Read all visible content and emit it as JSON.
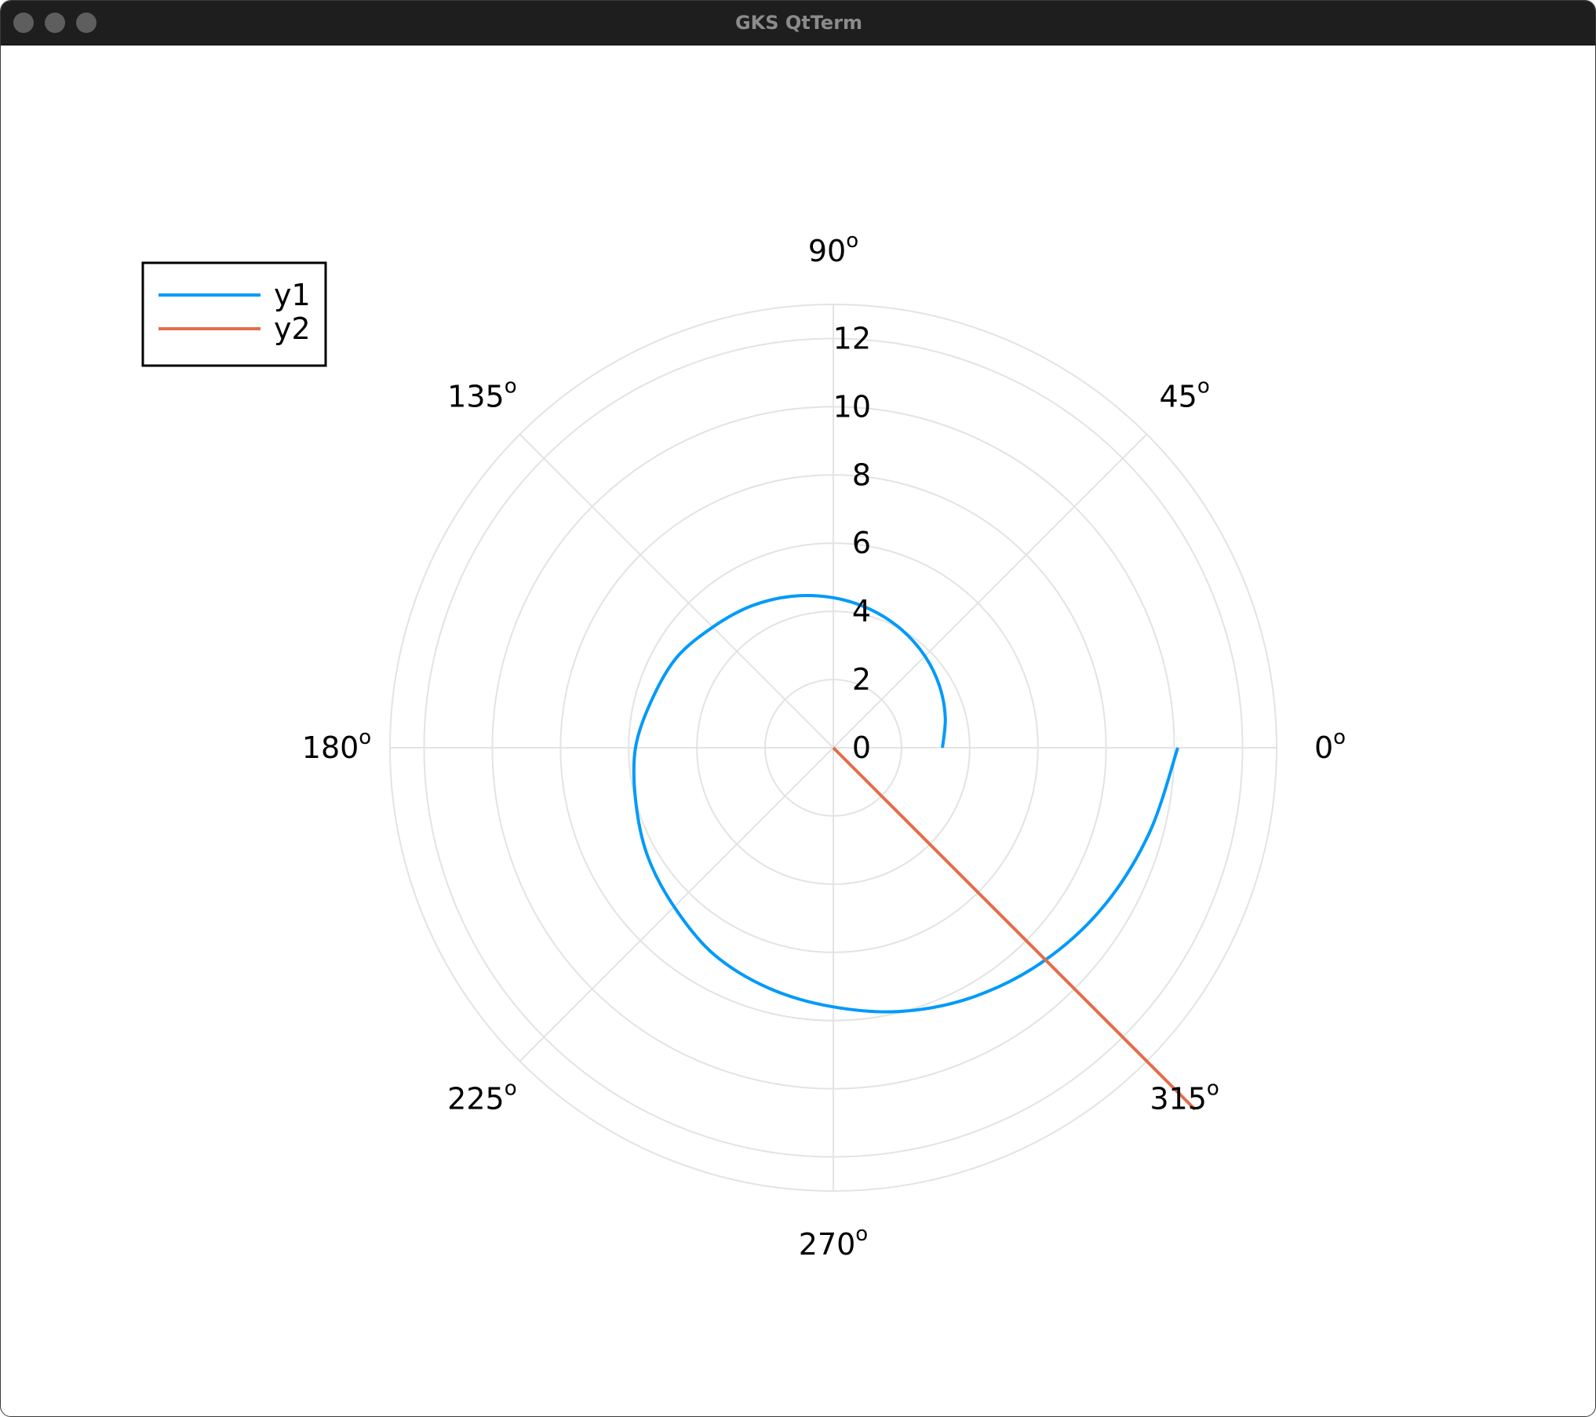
{
  "window": {
    "title": "GKS QtTerm",
    "traffic_lights": [
      "close",
      "minimize",
      "zoom"
    ],
    "colors": {
      "titlebar": "#1e1e1e",
      "title_text": "#8b8b8b",
      "traffic_light": "#5e5e5e"
    }
  },
  "chart_data": {
    "type": "line",
    "projection": "polar",
    "angle_unit": "degrees",
    "angle_ticks": [
      0,
      45,
      90,
      135,
      180,
      225,
      270,
      315
    ],
    "angle_tick_labels": [
      "0",
      "45",
      "90",
      "135",
      "180",
      "225",
      "270",
      "315"
    ],
    "angle_label_suffix": "o",
    "radial_ticks": [
      0,
      2,
      4,
      6,
      8,
      10,
      12
    ],
    "radial_tick_labels": [
      "0",
      "2",
      "4",
      "6",
      "8",
      "10",
      "12"
    ],
    "rlim": [
      0,
      13
    ],
    "grid": true,
    "legend_position": "top-left",
    "series": [
      {
        "name": "y1",
        "color": "#009af9",
        "theta_deg": [
          0,
          15,
          30,
          45,
          60,
          75,
          90,
          105,
          120,
          135,
          150,
          165,
          180,
          195,
          210,
          225,
          240,
          255,
          270,
          285,
          300,
          315,
          330,
          345,
          360
        ],
        "r": [
          3.2,
          3.4,
          3.6,
          3.8,
          4.0,
          4.2,
          4.4,
          4.6,
          4.8,
          5.0,
          5.3,
          5.5,
          5.8,
          6.0,
          6.3,
          6.6,
          7.0,
          7.3,
          7.6,
          8.0,
          8.4,
          8.8,
          9.2,
          9.6,
          10.1
        ]
      },
      {
        "name": "y2",
        "color": "#e26f46",
        "theta_deg": [
          315,
          315
        ],
        "r": [
          0,
          15.0
        ]
      }
    ]
  }
}
